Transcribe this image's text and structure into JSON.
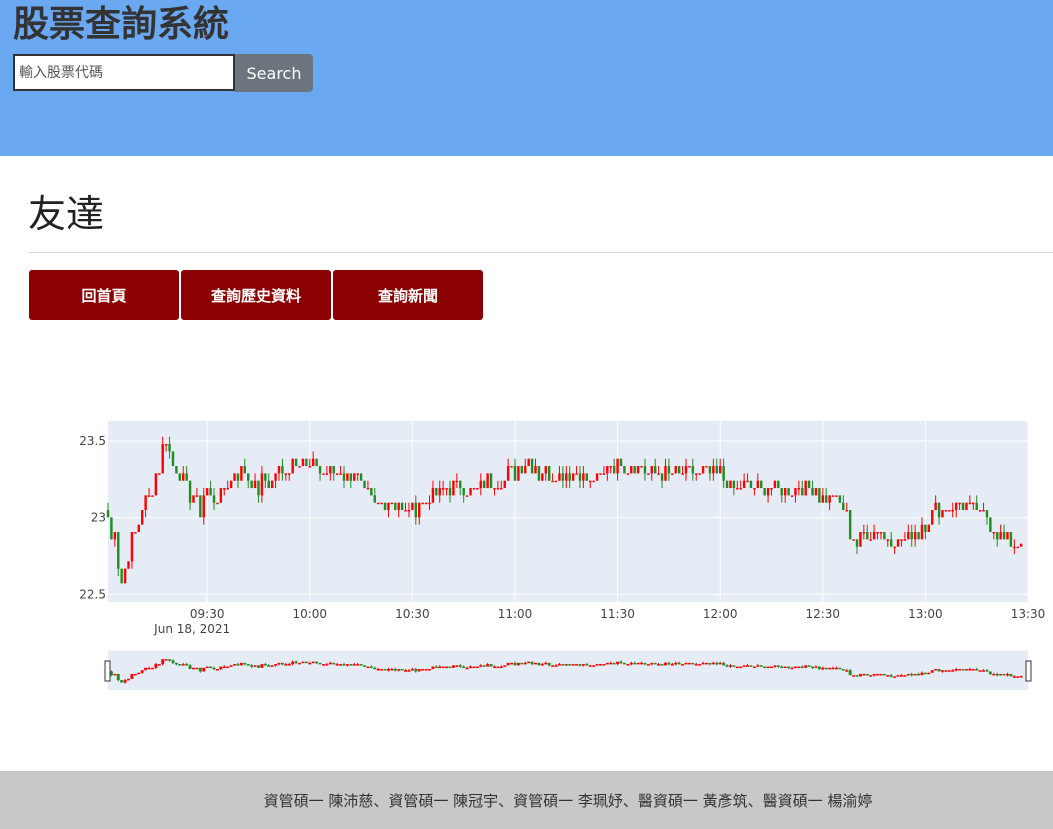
{
  "header": {
    "title": "股票查詢系統",
    "search_placeholder": "輸入股票代碼",
    "search_value": "",
    "search_label": "Search"
  },
  "stock": {
    "name": "友達"
  },
  "nav": {
    "home": "回首頁",
    "history": "查詢歷史資料",
    "news": "查詢新聞"
  },
  "footer": {
    "credits": "資管碩一 陳沛慈、資管碩一 陳冠宇、資管碩一 李珮妤、醫資碩一 黃彥筑、醫資碩一 楊渝婷"
  },
  "colors": {
    "header_bg": "#6aa8f2",
    "button_bg": "#8b0000",
    "up": "#ff0000",
    "down": "#228b22",
    "plot_bg": "#e5ecf6"
  },
  "chart_data": {
    "type": "candlestick",
    "title": "",
    "xlabel": "",
    "ylabel": "",
    "date_label": "Jun 18, 2021",
    "x_start": "09:01",
    "x_end": "13:30",
    "ylim": [
      22.45,
      23.63
    ],
    "y_ticks": [
      22.5,
      23,
      23.5
    ],
    "y_tick_labels": [
      "22.5",
      "23",
      "23.5"
    ],
    "x_ticks": [
      "09:30",
      "10:00",
      "10:30",
      "11:00",
      "11:30",
      "12:00",
      "12:30",
      "13:00",
      "13:30"
    ],
    "increasing_color": "#ff0000",
    "decreasing_color": "#228b22",
    "range_slider": true,
    "grid": true,
    "anchors": [
      [
        "09:01",
        23.0
      ],
      [
        "09:02",
        22.85
      ],
      [
        "09:03",
        22.95
      ],
      [
        "09:04",
        22.7
      ],
      [
        "09:05",
        22.55
      ],
      [
        "09:08",
        22.85
      ],
      [
        "09:10",
        22.95
      ],
      [
        "09:12",
        23.1
      ],
      [
        "09:14",
        23.2
      ],
      [
        "09:16",
        23.35
      ],
      [
        "09:17",
        23.5
      ],
      [
        "09:18",
        23.55
      ],
      [
        "09:20",
        23.35
      ],
      [
        "09:22",
        23.3
      ],
      [
        "09:24",
        23.2
      ],
      [
        "09:26",
        23.15
      ],
      [
        "09:28",
        23.05
      ],
      [
        "09:30",
        23.2
      ],
      [
        "09:32",
        23.1
      ],
      [
        "09:35",
        23.2
      ],
      [
        "09:38",
        23.3
      ],
      [
        "09:41",
        23.3
      ],
      [
        "09:44",
        23.2
      ],
      [
        "09:48",
        23.25
      ],
      [
        "09:52",
        23.3
      ],
      [
        "09:56",
        23.4
      ],
      [
        "10:00",
        23.35
      ],
      [
        "10:05",
        23.3
      ],
      [
        "10:10",
        23.3
      ],
      [
        "10:13",
        23.3
      ],
      [
        "10:15",
        23.2
      ],
      [
        "10:18",
        23.1
      ],
      [
        "10:22",
        23.1
      ],
      [
        "10:26",
        23.08
      ],
      [
        "10:30",
        23.05
      ],
      [
        "10:33",
        23.1
      ],
      [
        "10:36",
        23.15
      ],
      [
        "10:40",
        23.2
      ],
      [
        "10:45",
        23.22
      ],
      [
        "10:50",
        23.22
      ],
      [
        "10:55",
        23.25
      ],
      [
        "11:00",
        23.3
      ],
      [
        "11:02",
        23.35
      ],
      [
        "11:04",
        23.38
      ],
      [
        "11:07",
        23.3
      ],
      [
        "11:12",
        23.3
      ],
      [
        "11:18",
        23.28
      ],
      [
        "11:24",
        23.25
      ],
      [
        "11:27",
        23.35
      ],
      [
        "11:31",
        23.38
      ],
      [
        "11:35",
        23.35
      ],
      [
        "11:40",
        23.3
      ],
      [
        "11:45",
        23.3
      ],
      [
        "11:50",
        23.28
      ],
      [
        "11:56",
        23.3
      ],
      [
        "12:00",
        23.3
      ],
      [
        "12:03",
        23.2
      ],
      [
        "12:06",
        23.18
      ],
      [
        "12:12",
        23.18
      ],
      [
        "12:18",
        23.2
      ],
      [
        "12:24",
        23.18
      ],
      [
        "12:28",
        23.18
      ],
      [
        "12:32",
        23.15
      ],
      [
        "12:36",
        23.05
      ],
      [
        "12:38",
        22.9
      ],
      [
        "12:40",
        22.8
      ],
      [
        "12:42",
        22.88
      ],
      [
        "12:46",
        22.9
      ],
      [
        "12:48",
        22.85
      ],
      [
        "12:52",
        22.85
      ],
      [
        "12:56",
        22.88
      ],
      [
        "13:00",
        22.95
      ],
      [
        "13:02",
        23.05
      ],
      [
        "13:06",
        23.05
      ],
      [
        "13:09",
        23.1
      ],
      [
        "13:11",
        23.12
      ],
      [
        "13:14",
        23.05
      ],
      [
        "13:18",
        22.98
      ],
      [
        "13:22",
        22.88
      ],
      [
        "13:25",
        22.82
      ],
      [
        "13:27",
        22.8
      ],
      [
        "13:28",
        22.82
      ]
    ]
  }
}
